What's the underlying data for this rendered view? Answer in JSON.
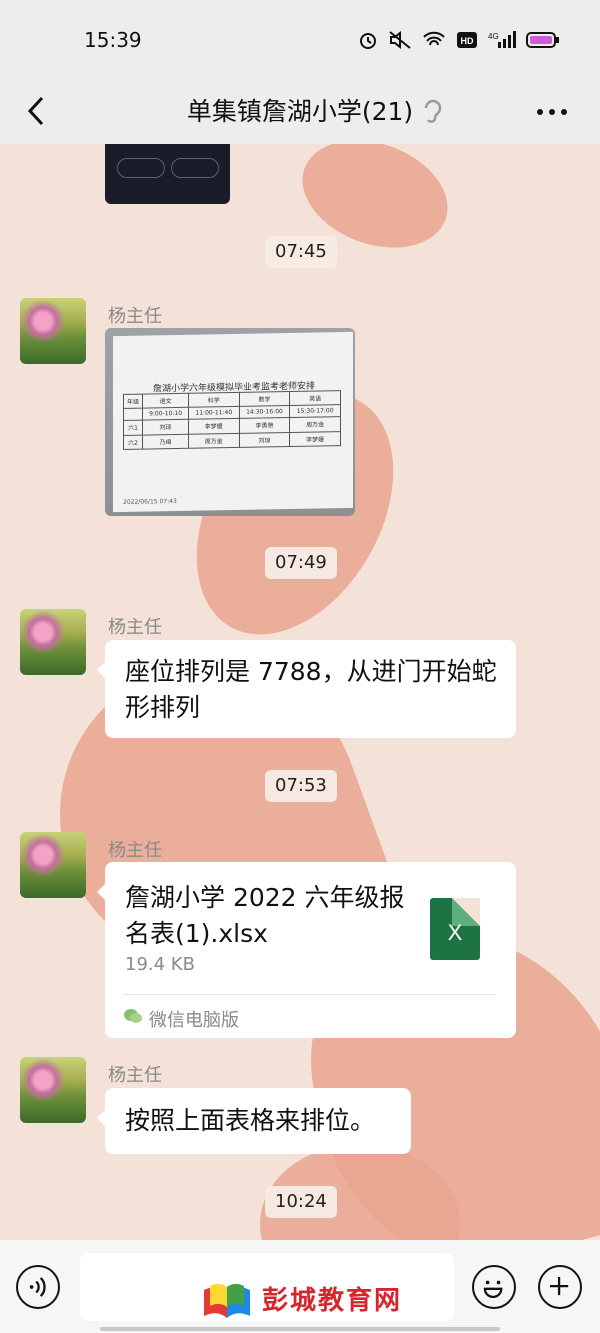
{
  "status": {
    "time": "15:39",
    "icons": [
      "alarm-icon",
      "mute-icon",
      "wifi-icon",
      "hd-icon",
      "signal-4g-icon",
      "battery-icon"
    ]
  },
  "header": {
    "title": "单集镇詹湖小学(21)",
    "back_icon": "chevron-left-icon",
    "ear_icon": "ear-icon",
    "more_icon": "more-icon"
  },
  "messages": [
    {
      "type": "timestamp",
      "text": "07:45"
    },
    {
      "type": "image",
      "sender": "杨主任",
      "doc": {
        "title": "詹湖小学六年级模拟毕业考监考老师安排",
        "table": [
          [
            "年级",
            "语文",
            "科学",
            "数学",
            "英语"
          ],
          [
            "",
            "9:00-10:10",
            "11:00-11:40",
            "14:30-16:00",
            "15:30-17:00"
          ],
          [
            "六1",
            "刘琼",
            "李梦媛",
            "李勇艳",
            "周万金"
          ],
          [
            "六2",
            "乃绵",
            "周万金",
            "刘琼",
            "李梦媛"
          ]
        ],
        "stamp": "2022/06/15 07:43"
      }
    },
    {
      "type": "timestamp",
      "text": "07:49"
    },
    {
      "type": "text",
      "sender": "杨主任",
      "text": "座位排列是 7788，从进门开始蛇形排列"
    },
    {
      "type": "timestamp",
      "text": "07:53"
    },
    {
      "type": "file",
      "sender": "杨主任",
      "filename": "詹湖小学 2022 六年级报名表(1).xlsx",
      "size": "19.4 KB",
      "source": "微信电脑版",
      "icon_letter": "X"
    },
    {
      "type": "text",
      "sender": "杨主任",
      "text": "按照上面表格来排位。"
    },
    {
      "type": "timestamp",
      "text": "10:24"
    }
  ],
  "bottom": {
    "watermark": "彭城教育网",
    "voice_icon": "voice-icon",
    "emoji_icon": "emoji-icon",
    "plus_icon": "plus-icon"
  },
  "colors": {
    "accent": "#1e7345",
    "watermark": "#d6252c",
    "wallpaper": "#f4e2d8",
    "heart": "#e9a48f"
  }
}
